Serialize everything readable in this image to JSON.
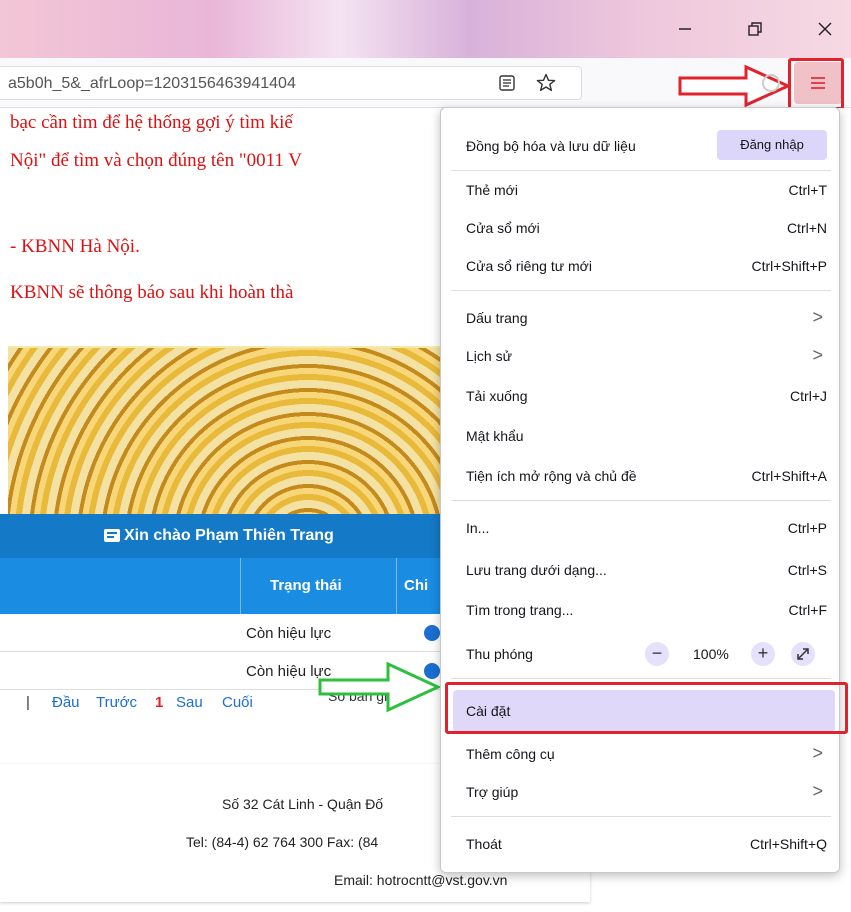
{
  "browser": {
    "url": "a5b0h_5&_afrLoop=1203156463941404",
    "icons": [
      "reader-view-icon",
      "bookmark-star-icon",
      "app-menu-icon"
    ]
  },
  "page": {
    "lines": [
      "bạc cần tìm để hệ thống gợi ý tìm kiế",
      "Nội\" để tìm và chọn đúng tên \"0011 V",
      "- KBNN Hà Nội.",
      "KBNN sẽ thông báo sau khi hoàn thà"
    ],
    "greeting": "Xin chào Phạm Thiên Trang",
    "table": {
      "headers": [
        "Trạng thái",
        "Chi"
      ],
      "rows": [
        "Còn hiệu lực",
        "Còn hiệu lực"
      ]
    },
    "pager": {
      "sep": "|",
      "first": "Đầu",
      "prev": "Trước",
      "current": "1",
      "next": "Sau",
      "last": "Cuối",
      "record": "Số bản ghi h"
    },
    "footer": {
      "address": "Số 32 Cát Linh - Quận Đố",
      "phone": "Tel: (84-4) 62 764 300 Fax: (84",
      "email": "Email: hotrocntt@vst.gov.vn"
    }
  },
  "menu": {
    "sync": {
      "label": "Đồng bộ hóa và lưu dữ liệu",
      "button": "Đăng nhập"
    },
    "items": [
      {
        "label": "Thẻ mới",
        "shortcut": "Ctrl+T"
      },
      {
        "label": "Cửa sổ mới",
        "shortcut": "Ctrl+N"
      },
      {
        "label": "Cửa sổ riêng tư mới",
        "shortcut": "Ctrl+Shift+P"
      },
      {
        "label": "Dấu trang",
        "shortcut": ">"
      },
      {
        "label": "Lịch sử",
        "shortcut": ">"
      },
      {
        "label": "Tải xuống",
        "shortcut": "Ctrl+J"
      },
      {
        "label": "Mật khẩu",
        "shortcut": ""
      },
      {
        "label": "Tiện ích mở rộng và chủ đề",
        "shortcut": "Ctrl+Shift+A"
      },
      {
        "label": "In...",
        "shortcut": "Ctrl+P"
      },
      {
        "label": "Lưu trang dưới dạng...",
        "shortcut": "Ctrl+S"
      },
      {
        "label": "Tìm trong trang...",
        "shortcut": "Ctrl+F"
      },
      {
        "label": "Thu phóng",
        "shortcut": ""
      },
      {
        "label": "Cài đặt",
        "shortcut": ""
      },
      {
        "label": "Thêm công cụ",
        "shortcut": ">"
      },
      {
        "label": "Trợ giúp",
        "shortcut": ">"
      },
      {
        "label": "Thoát",
        "shortcut": "Ctrl+Shift+Q"
      }
    ],
    "zoom": {
      "minus": "−",
      "value": "100%",
      "plus": "+"
    }
  },
  "colors": {
    "accent": "#e0222d",
    "arrow_green": "#2fbf3f",
    "menu_highlight": "#e0d8f8"
  }
}
